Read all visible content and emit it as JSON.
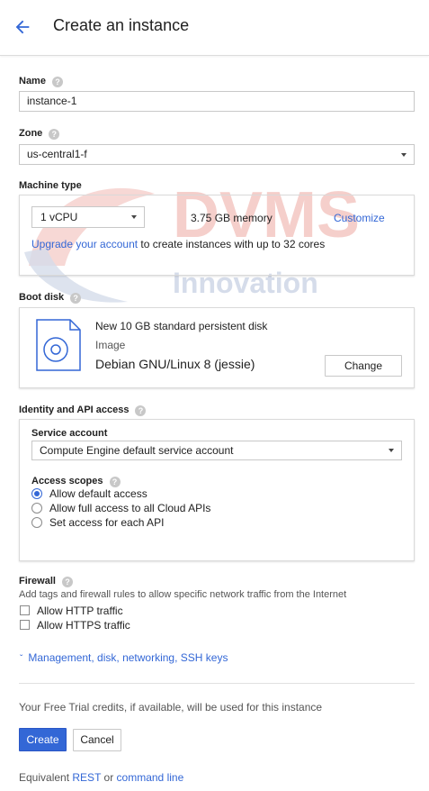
{
  "header": {
    "title": "Create an instance",
    "back_icon": "arrow-back-icon"
  },
  "watermark": {
    "title": "DVMS",
    "subtitle": "Innovation"
  },
  "name": {
    "label": "Name",
    "value": "instance-1"
  },
  "zone": {
    "label": "Zone",
    "value": "us-central1-f"
  },
  "machine_type": {
    "label": "Machine type",
    "cpu_value": "1 vCPU",
    "memory": "3.75 GB memory",
    "customize": "Customize",
    "upgrade_link": "Upgrade your account",
    "upgrade_text": "to create instances with up to 32 cores"
  },
  "boot_disk": {
    "label": "Boot disk",
    "disk_title": "New 10 GB standard persistent disk",
    "image_label": "Image",
    "image_value": "Debian GNU/Linux 8 (jessie)",
    "change_button": "Change"
  },
  "identity": {
    "label": "Identity and API access",
    "service_account_label": "Service account",
    "service_account_value": "Compute Engine default service account",
    "access_scopes_label": "Access scopes",
    "scopes": [
      {
        "label": "Allow default access",
        "selected": true
      },
      {
        "label": "Allow full access to all Cloud APIs",
        "selected": false
      },
      {
        "label": "Set access for each API",
        "selected": false
      }
    ]
  },
  "firewall": {
    "label": "Firewall",
    "description": "Add tags and firewall rules to allow specific network traffic from the Internet",
    "options": [
      {
        "label": "Allow HTTP traffic",
        "checked": false
      },
      {
        "label": "Allow HTTPS traffic",
        "checked": false
      }
    ]
  },
  "management_link": "Management, disk, networking, SSH keys",
  "free_trial_text": "Your Free Trial credits, if available, will be used for this instance",
  "buttons": {
    "create": "Create",
    "cancel": "Cancel"
  },
  "footer": {
    "equivalent": "Equivalent",
    "rest": "REST",
    "or": "or",
    "command_line": "command line"
  },
  "colors": {
    "primary": "#3367d6",
    "watermark_red": "#f4c7c3",
    "watermark_blue": "#d5dcea"
  }
}
